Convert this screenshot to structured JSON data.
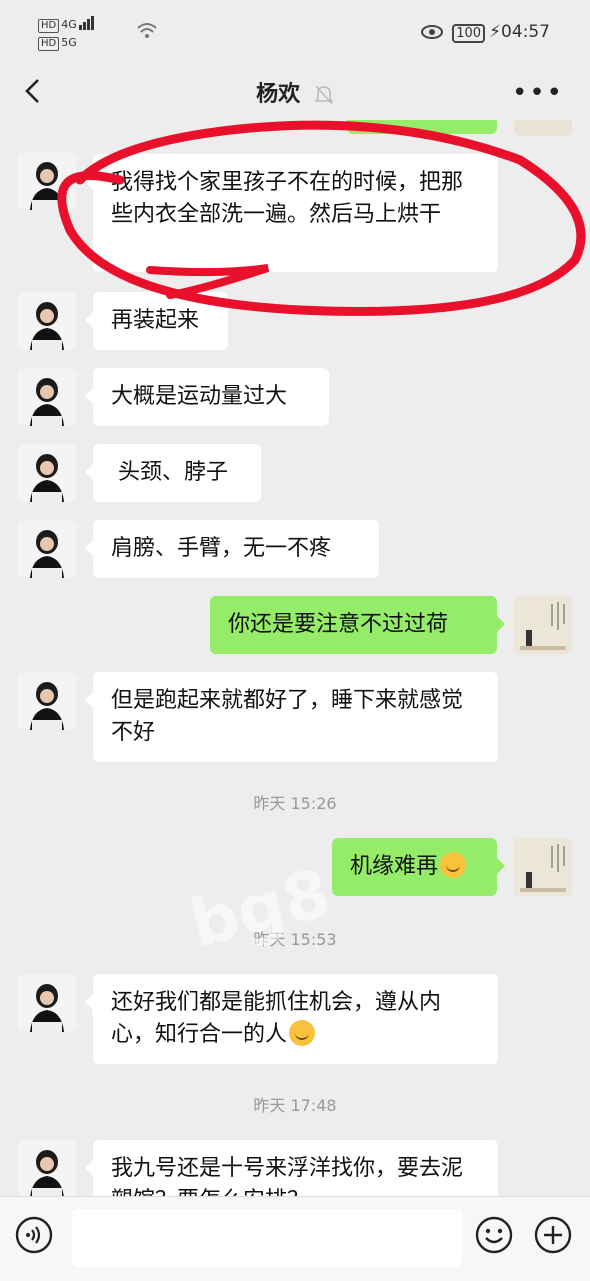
{
  "status_bar": {
    "hd1": "HD",
    "hd2": "HD",
    "net1": "4G",
    "net2": "5G",
    "battery": "100",
    "time": "04:57"
  },
  "nav": {
    "title": "杨欢",
    "back_icon": "chevron-left-icon",
    "mute_icon": "bell-muted-icon",
    "more_icon": "more-dots-icon"
  },
  "messages": [
    {
      "side": "left",
      "text": "我得找个家里孩子不在的时候，把那些内衣全部洗一遍。然后马上烘干"
    },
    {
      "side": "left",
      "text": "再装起来"
    },
    {
      "side": "left",
      "text": "大概是运动量过大"
    },
    {
      "side": "left",
      "text": " 头颈、脖子"
    },
    {
      "side": "left",
      "text": "肩膀、手臂，无一不疼"
    },
    {
      "side": "right",
      "text": "你还是要注意不过过荷"
    },
    {
      "side": "left",
      "text": "但是跑起来就都好了，睡下来就感觉不好"
    },
    {
      "side": "time",
      "text": "昨天 15:26"
    },
    {
      "side": "right",
      "text": "机缘难再",
      "emoji": "laugh-cry-emoji"
    },
    {
      "side": "time",
      "text": "昨天 15:53"
    },
    {
      "side": "left",
      "text": "还好我们都是能抓住机会，遵从内心，知行合一的人",
      "emoji": "smile-emoji"
    },
    {
      "side": "time",
      "text": "昨天 17:48"
    },
    {
      "side": "left",
      "text": "我九号还是十号来浮洋找你，要去泥塑馆？要怎么安排？"
    }
  ],
  "watermark": "bg8",
  "input": {
    "placeholder": "",
    "voice_icon": "voice-icon",
    "emoji_icon": "emoji-icon",
    "plus_icon": "plus-icon"
  },
  "colors": {
    "background": "#ededed",
    "sent_bubble": "#95ec69",
    "received_bubble": "#ffffff",
    "annotation_circle": "#e8102a"
  }
}
